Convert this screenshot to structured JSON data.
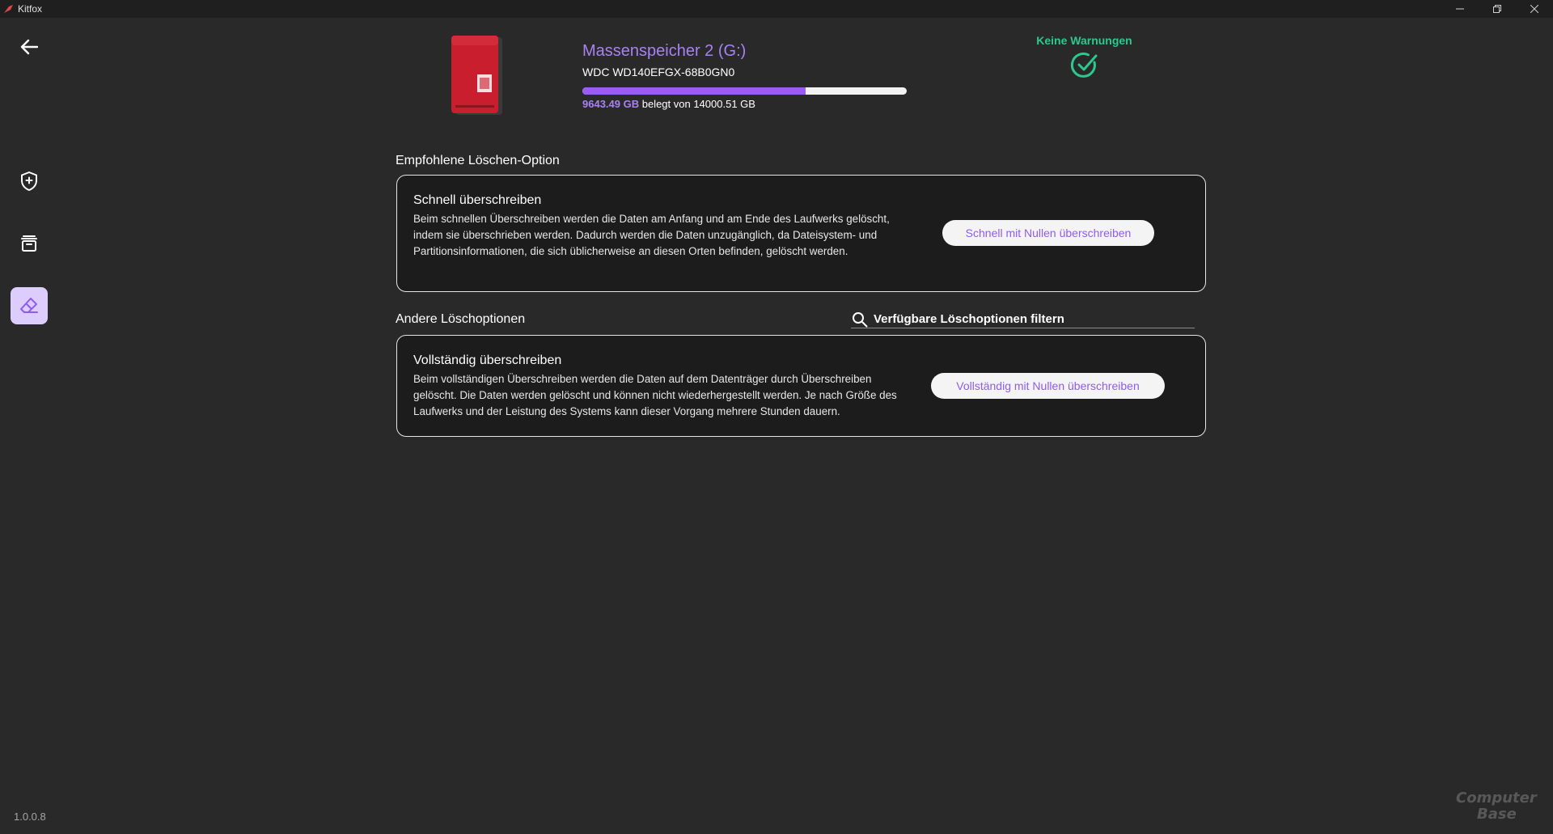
{
  "window": {
    "title": "Kitfox",
    "controls": [
      "minimize-icon",
      "restore-icon",
      "close-icon"
    ]
  },
  "sidebar": {
    "items": [
      {
        "name": "back-arrow-icon",
        "active": false
      },
      {
        "name": "shield-plus-icon",
        "active": false
      },
      {
        "name": "archive-icon",
        "active": false
      },
      {
        "name": "eraser-icon",
        "active": true
      }
    ],
    "version": "1.0.0.8"
  },
  "drive": {
    "image_label": "WD Red Plus",
    "name": "Massenspeicher 2 (G:)",
    "model": "WDC WD140EFGX-68B0GN0",
    "used": "9643.49 GB",
    "usage_middle": " belegt von ",
    "total": "14000.51 GB",
    "used_fraction": 0.689
  },
  "status": {
    "label": "Keine Warnungen",
    "icon": "check-circle-icon",
    "color": "#2bc98f"
  },
  "recommended": {
    "section_title": "Empfohlene Löschen-Option",
    "title": "Schnell überschreiben",
    "description": "Beim schnellen Überschreiben werden die Daten am Anfang und am Ende des Laufwerks gelöscht, indem sie überschrieben werden. Dadurch werden die Daten unzugänglich, da Dateisystem- und Partitionsinformationen, die sich üblicherweise an diesen Orten befinden, gelöscht werden.",
    "button": "Schnell mit Nullen überschreiben"
  },
  "other": {
    "section_title": "Andere Löschoptionen",
    "filter_placeholder": "Verfügbare Löschoptionen filtern",
    "options": [
      {
        "title": "Vollständig überschreiben",
        "description": "Beim vollständigen Überschreiben werden die Daten auf dem Datenträger durch Überschreiben gelöscht. Die Daten werden gelöscht und können nicht wiederhergestellt werden. Je nach Größe des Laufwerks und der Leistung des Systems kann dieser Vorgang mehrere Stunden dauern.",
        "button": "Vollständig mit Nullen überschreiben"
      }
    ]
  },
  "watermark": {
    "line1": "Computer",
    "line2": "Base"
  },
  "colors": {
    "background": "#292929",
    "accent": "#a981f5",
    "progress": "#9b5cf5",
    "success": "#2bc98f"
  }
}
